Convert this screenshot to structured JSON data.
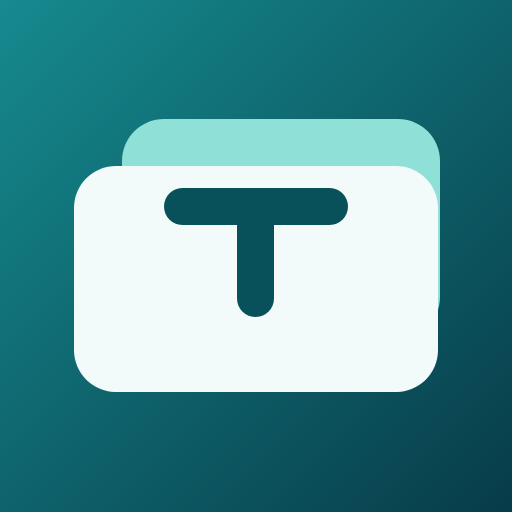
{
  "icon": {
    "name": "stacked-cards-t-icon",
    "colors": {
      "background_start": "#168a8f",
      "background_end": "#073c49",
      "back_card": "#8fe0d6",
      "front_card": "#f3fbfa",
      "letter": "#08515a"
    }
  }
}
